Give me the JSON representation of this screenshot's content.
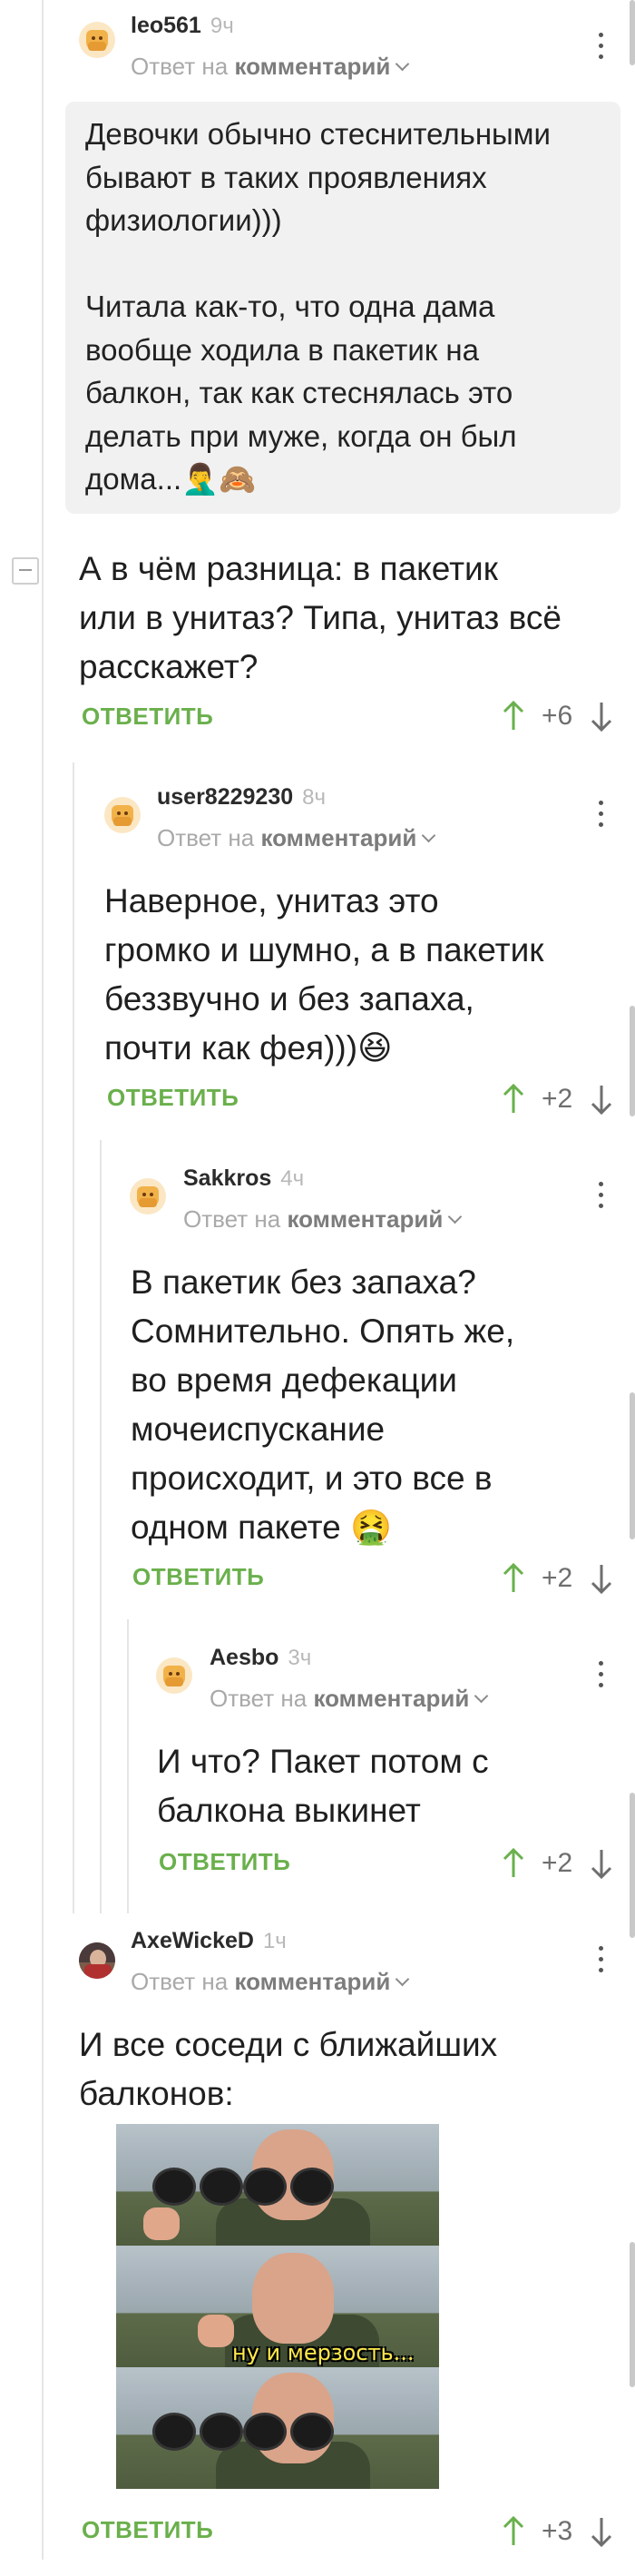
{
  "comments": [
    {
      "author": "leo561",
      "time": "9ч",
      "reply_prefix": "Ответ на",
      "reply_target": "комментарий",
      "quote_lines": [
        "Девочки обычно стеснительными",
        "бывают в таких проявлениях",
        "физиологии)))",
        "",
        "Читала как-то, что одна дама",
        "вообще ходила в пакетик на",
        "балкон, так как стеснялась это",
        "делать при муже, когда он был",
        "дома...🤦‍♂️🙈"
      ],
      "body_lines": [
        "А в чём разница: в пакетик",
        "или в унитаз? Типа, унитаз всё",
        "расскажет?"
      ],
      "reply_label": "ОТВЕТИТЬ",
      "score": "+6"
    },
    {
      "author": "user8229230",
      "time": "8ч",
      "reply_prefix": "Ответ на",
      "reply_target": "комментарий",
      "body_lines": [
        "Наверное, унитаз это",
        "громко и шумно, а в пакетик",
        "беззвучно и без запаха,",
        "почти как фея)))😆"
      ],
      "reply_label": "ОТВЕТИТЬ",
      "score": "+2"
    },
    {
      "author": "Sakkros",
      "time": "4ч",
      "reply_prefix": "Ответ на",
      "reply_target": "комментарий",
      "body_lines": [
        "В пакетик без запаха?",
        "Сомнительно. Опять же,",
        "во время дефекации",
        "мочеиспускание",
        "происходит, и это все в",
        "одном пакете 🤮"
      ],
      "reply_label": "ОТВЕТИТЬ",
      "score": "+2"
    },
    {
      "author": "Aesbo",
      "time": "3ч",
      "reply_prefix": "Ответ на",
      "reply_target": "комментарий",
      "body_lines": [
        "И что? Пакет потом с",
        "балкона выкинет"
      ],
      "reply_label": "ОТВЕТИТЬ",
      "score": "+2"
    },
    {
      "author": "AxeWickeD",
      "time": "1ч",
      "reply_prefix": "Ответ на",
      "reply_target": "комментарий",
      "body_lines": [
        "И все соседи с ближайших",
        "балконов:"
      ],
      "meme_caption": "ну и мерзость...",
      "reply_label": "ОТВЕТИТЬ",
      "score": "+3"
    }
  ],
  "colors": {
    "accent_green": "#6ab04c",
    "quote_bg": "#f1f1f1"
  },
  "icons": [
    "kebab-menu-icon",
    "chevron-down-icon",
    "arrow-up-icon",
    "arrow-down-icon",
    "collapse-icon"
  ]
}
